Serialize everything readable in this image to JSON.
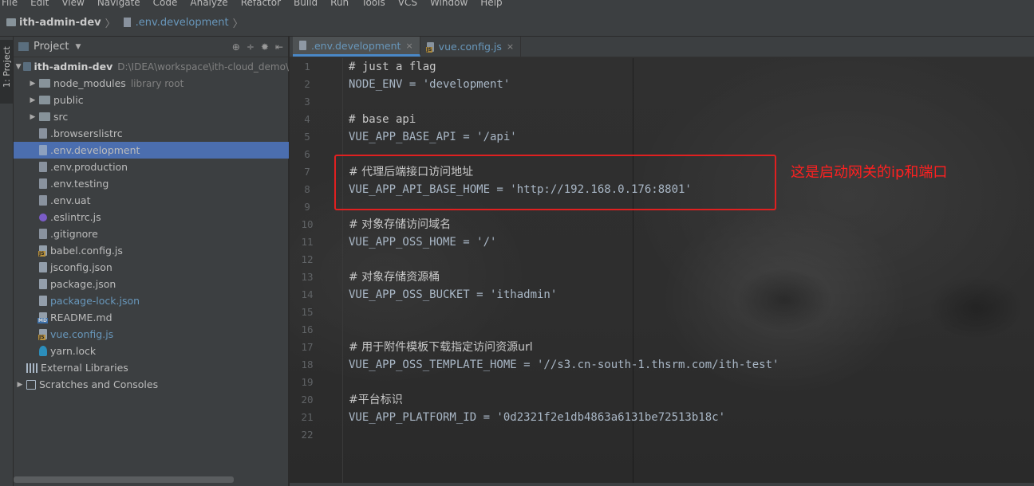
{
  "menu": [
    "File",
    "Edit",
    "View",
    "Navigate",
    "Code",
    "Analyze",
    "Refactor",
    "Build",
    "Run",
    "Tools",
    "VCS",
    "Window",
    "Help"
  ],
  "navbar": {
    "project": "ith-admin-dev",
    "file": ".env.development"
  },
  "toolstrip": {
    "project_tab": "1: Project"
  },
  "project_panel": {
    "title": "Project",
    "root": {
      "name": "ith-admin-dev",
      "path": "D:\\IDEA\\workspace\\ith-cloud_demo\\"
    },
    "items": [
      {
        "label": "node_modules",
        "hint": "library root",
        "type": "folder"
      },
      {
        "label": "public",
        "type": "folder"
      },
      {
        "label": "src",
        "type": "folder"
      },
      {
        "label": ".browserslistrc",
        "type": "file"
      },
      {
        "label": ".env.development",
        "type": "file"
      },
      {
        "label": ".env.production",
        "type": "file"
      },
      {
        "label": ".env.testing",
        "type": "file"
      },
      {
        "label": ".env.uat",
        "type": "file"
      },
      {
        "label": ".eslintrc.js",
        "type": "eslint"
      },
      {
        "label": ".gitignore",
        "type": "file"
      },
      {
        "label": "babel.config.js",
        "type": "js"
      },
      {
        "label": "jsconfig.json",
        "type": "json"
      },
      {
        "label": "package.json",
        "type": "json"
      },
      {
        "label": "package-lock.json",
        "type": "json"
      },
      {
        "label": "README.md",
        "type": "md"
      },
      {
        "label": "vue.config.js",
        "type": "js"
      },
      {
        "label": "yarn.lock",
        "type": "yarn"
      }
    ],
    "external_libraries": "External Libraries",
    "scratches": "Scratches and Consoles"
  },
  "tabs": [
    {
      "label": ".env.development",
      "active": true
    },
    {
      "label": "vue.config.js",
      "active": false
    }
  ],
  "code": [
    "# just a flag",
    "NODE_ENV = 'development'",
    "",
    "# base api",
    "VUE_APP_BASE_API = '/api'",
    "",
    "# 代理后端接口访问地址",
    "VUE_APP_API_BASE_HOME = 'http://192.168.0.176:8801'",
    "",
    "# 对象存储访问域名",
    "VUE_APP_OSS_HOME = '/'",
    "",
    "# 对象存储资源桶",
    "VUE_APP_OSS_BUCKET = 'ithadmin'",
    "",
    "",
    "# 用于附件模板下载指定访问资源url",
    "VUE_APP_OSS_TEMPLATE_HOME = '//s3.cn-south-1.thsrm.com/ith-test'",
    "",
    "#平台标识",
    "VUE_APP_PLATFORM_ID = '0d2321f2e1db4863a6131be72513b18c'",
    ""
  ],
  "line_numbers": [
    "1",
    "2",
    "3",
    "4",
    "5",
    "6",
    "7",
    "8",
    "9",
    "10",
    "11",
    "12",
    "13",
    "14",
    "15",
    "16",
    "17",
    "18",
    "19",
    "20",
    "21",
    "22"
  ],
  "annotation": "这是启动网关的ip和端口",
  "colors": {
    "selection": "#4b6eaf",
    "annotation": "#ff2020",
    "link": "#6897bb"
  }
}
